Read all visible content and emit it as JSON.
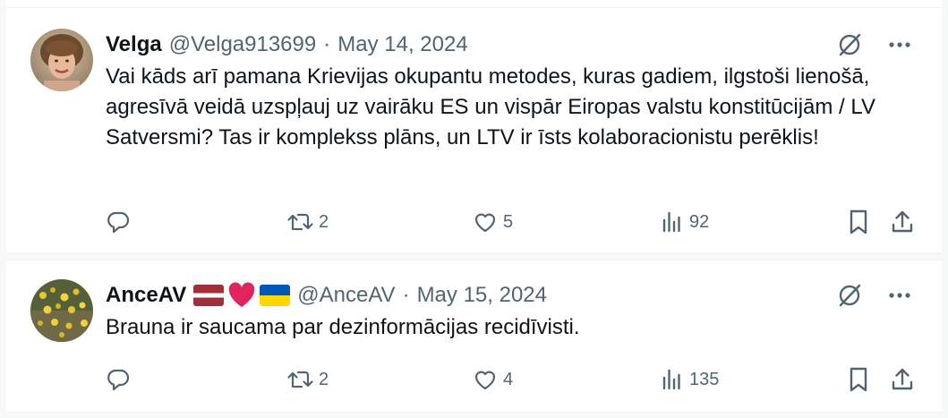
{
  "tweets": [
    {
      "name": "Velga",
      "handle": "@Velga913699",
      "separator": "·",
      "date": "May 14, 2024",
      "text": "Vai kāds arī pamana Krievijas okupantu metodes, kuras gadiem, ilgstoši lienošā, agresīvā veidā uzspļauj uz vairāku ES un vispār Eiropas valstu konstitūcijām / LV Satversmi? Tas ir komplekss plāns, un LTV ir īsts kolaboracionistu perēklis!",
      "replies": "",
      "reposts": "2",
      "likes": "5",
      "views": "92",
      "icons": [
        "grok-icon",
        "more-icon",
        "reply-icon",
        "retweet-icon",
        "like-icon",
        "views-icon",
        "bookmark-icon",
        "share-icon"
      ]
    },
    {
      "name": "AnceAV",
      "name_emojis": [
        "latvia-flag",
        "red-heart",
        "ukraine-flag"
      ],
      "handle": "@AnceAV",
      "separator": "·",
      "date": "May 15, 2024",
      "text": "Brauna  ir saucama par dezinformācijas  recidīvisti.",
      "replies": "",
      "reposts": "2",
      "likes": "4",
      "views": "135",
      "icons": [
        "grok-icon",
        "more-icon",
        "reply-icon",
        "retweet-icon",
        "like-icon",
        "views-icon",
        "bookmark-icon",
        "share-icon"
      ]
    }
  ],
  "colors": {
    "text": "#0f1419",
    "secondary": "#536471",
    "divider": "#eff3f4",
    "background": "#ffffff",
    "latvia_red": "#9e3039",
    "heart_red": "#e0245e",
    "ukraine_blue": "#0057b7",
    "ukraine_yellow": "#ffd700"
  }
}
